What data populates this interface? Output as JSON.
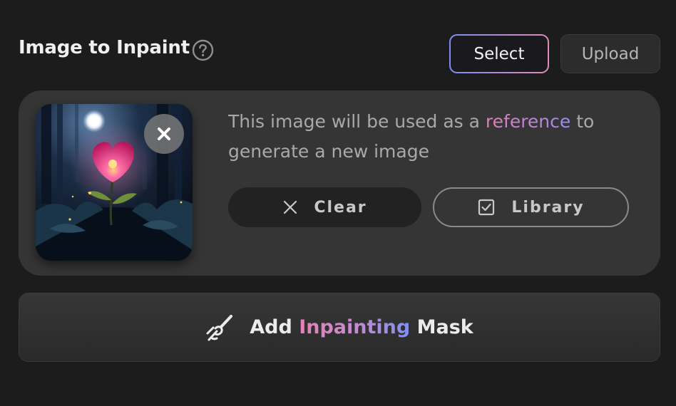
{
  "header": {
    "title": "Image to Inpaint",
    "help_icon": "question-circle-icon",
    "select_label": "Select",
    "upload_label": "Upload"
  },
  "card": {
    "thumbnail_alt": "glowing heart-shaped flower in a moonlit forest",
    "remove_icon": "close-icon",
    "description_before": "This image will be used as a ",
    "description_highlight": "reference",
    "description_after": " to generate a new image",
    "clear_label": "Clear",
    "clear_icon": "x-icon",
    "library_label": "Library",
    "library_icon": "checkbox-icon"
  },
  "mask": {
    "icon": "brush-icon",
    "label_before": "Add ",
    "label_highlight": "Inpainting",
    "label_after": " Mask"
  },
  "colors": {
    "background": "#1c1c1c",
    "card": "#353535",
    "accent_pink": "#e483b7",
    "accent_blue": "#7f8ff2"
  }
}
